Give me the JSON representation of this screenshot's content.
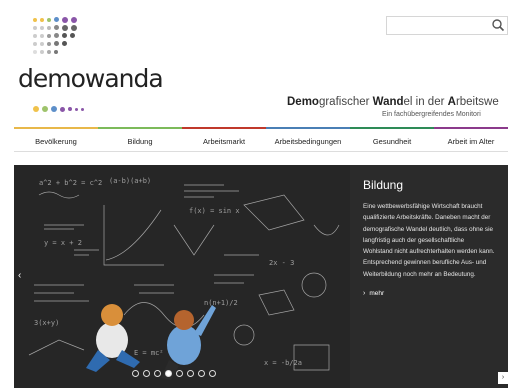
{
  "colors": {
    "nav_bevoelkerung": "#e8b84a",
    "nav_bildung": "#7cba5a",
    "nav_arbeitsmarkt": "#c0392b",
    "nav_arbeitsbedingungen": "#4a7fb5",
    "nav_gesundheit": "#2e8b57",
    "nav_arbeit_im_alter": "#8b3a8b",
    "hero_panel_bg": "#2b2b2b"
  },
  "brand": {
    "name": "demowanda"
  },
  "tagline": {
    "part1": "Demo",
    "part2": "grafischer ",
    "part3": "Wand",
    "part4": "el in der ",
    "part5": "A",
    "part6": "rbeitswe",
    "subtitle": "Ein fachübergreifendes Monitori"
  },
  "search": {
    "icon": "search-icon"
  },
  "nav": {
    "items": [
      {
        "label": "Bevölkerung"
      },
      {
        "label": "Bildung"
      },
      {
        "label": "Arbeitsmarkt"
      },
      {
        "label": "Arbeitsbedingungen"
      },
      {
        "label": "Gesundheit"
      },
      {
        "label": "Arbeit im Alter"
      }
    ]
  },
  "hero": {
    "panel": {
      "title": "Bildung",
      "body": "Eine wettbewerbsfähige Wirtschaft braucht qualifizierte Arbeitskräfte. Daneben macht der demografische Wandel deutlich, dass ohne sie langfristig auch der gesellschaftliche Wohlstand nicht aufrechterhalten werden kann. Entsprechend gewinnen berufliche Aus- und Weiterbildung noch mehr an Bedeutung.",
      "more": "mehr"
    },
    "pager": {
      "count": 8,
      "active": 3
    },
    "arrow_left": "‹",
    "arrow_right": "›"
  }
}
